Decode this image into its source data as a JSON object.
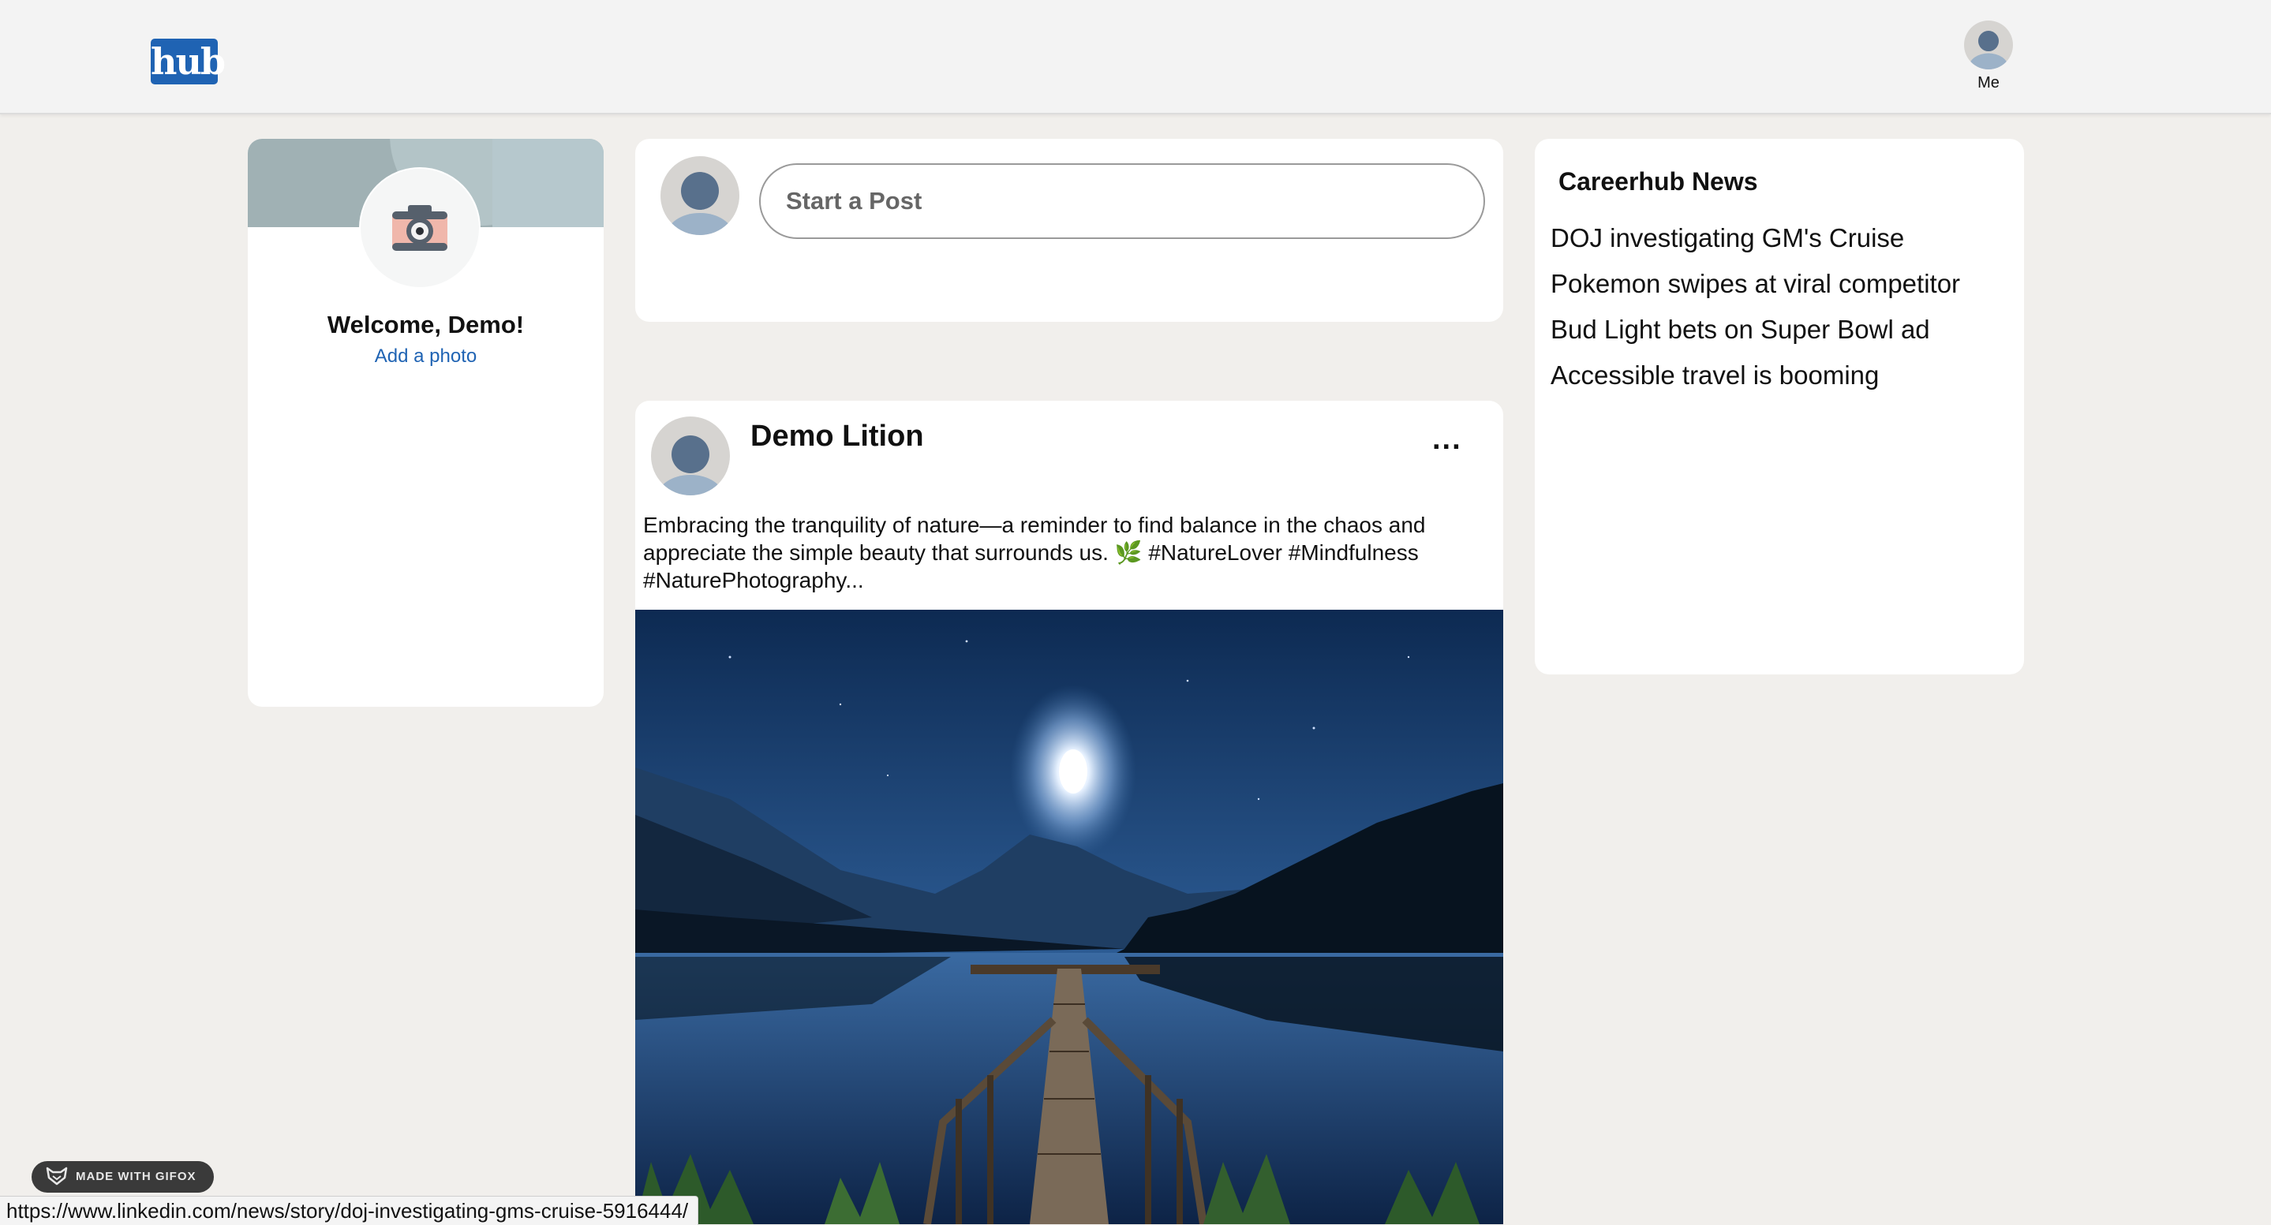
{
  "header": {
    "logo_text": "hub",
    "me_label": "Me"
  },
  "profile": {
    "welcome": "Welcome, Demo!",
    "add_photo": "Add a photo"
  },
  "composer": {
    "placeholder": "Start a Post"
  },
  "post": {
    "author": "Demo Lition",
    "more": "...",
    "text": "Embracing the tranquility of nature—a reminder to find balance in the chaos and appreciate the simple beauty that surrounds us. 🌿 #NatureLover #Mindfulness #NaturePhotography..."
  },
  "news": {
    "title": "Careerhub News",
    "items": [
      "DOJ investigating GM's Cruise",
      "Pokemon swipes at viral competitor",
      "Bud Light bets on Super Bowl ad",
      "Accessible travel is booming"
    ]
  },
  "status": {
    "url": "https://www.linkedin.com/news/story/doj-investigating-gms-cruise-5916444/",
    "gifox_label": "MADE WITH GIFOX"
  },
  "colors": {
    "brand": "#1f63b3",
    "background": "#f1efec",
    "card": "#ffffff"
  },
  "icons": {
    "avatar": "default-user-avatar-icon",
    "camera": "camera-icon",
    "more": "more-options-icon",
    "gifox": "gifox-fox-icon"
  }
}
